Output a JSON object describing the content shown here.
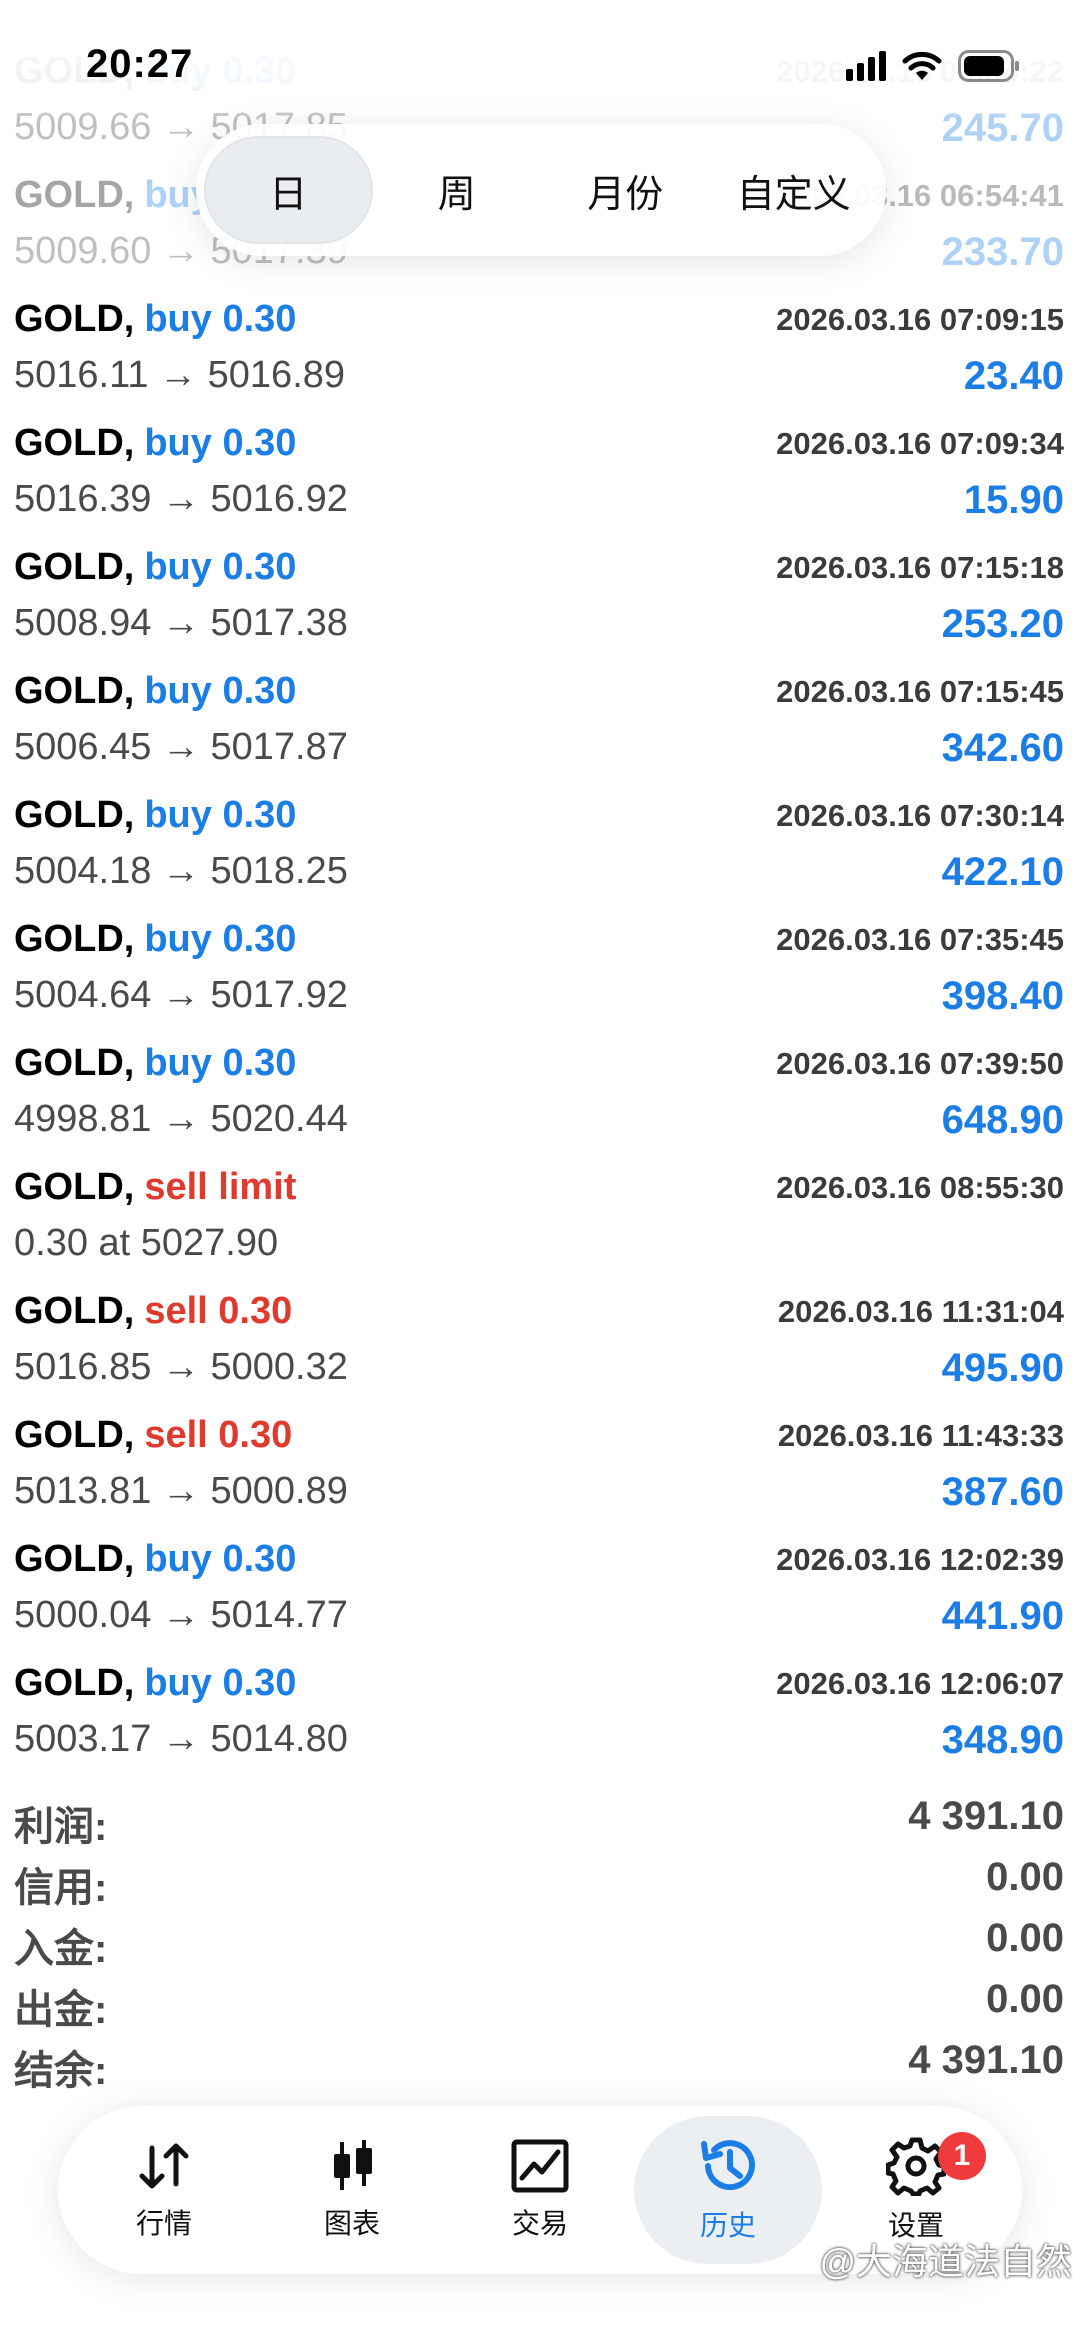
{
  "status_bar": {
    "time": "20:27"
  },
  "period_tabs": [
    {
      "label": "日",
      "active": true
    },
    {
      "label": "周",
      "active": false
    },
    {
      "label": "月份",
      "active": false
    },
    {
      "label": "自定义",
      "active": false
    }
  ],
  "trades": [
    {
      "symbol": "GOLD,",
      "side": "buy",
      "side_label": "buy 0.30",
      "time": "2026.03.16 06:54:22",
      "prices": "5009.66 → 5017.85",
      "profit": "245.70",
      "faded": true
    },
    {
      "symbol": "GOLD,",
      "side": "buy",
      "side_label": "buy 0.30",
      "time": "2026.03.16 06:54:41",
      "prices": "5009.60 → 5017.39",
      "profit": "233.70",
      "faded": true
    },
    {
      "symbol": "GOLD,",
      "side": "buy",
      "side_label": "buy 0.30",
      "time": "2026.03.16 07:09:15",
      "prices": "5016.11 → 5016.89",
      "profit": "23.40",
      "faded": false
    },
    {
      "symbol": "GOLD,",
      "side": "buy",
      "side_label": "buy 0.30",
      "time": "2026.03.16 07:09:34",
      "prices": "5016.39 → 5016.92",
      "profit": "15.90",
      "faded": false
    },
    {
      "symbol": "GOLD,",
      "side": "buy",
      "side_label": "buy 0.30",
      "time": "2026.03.16 07:15:18",
      "prices": "5008.94 → 5017.38",
      "profit": "253.20",
      "faded": false
    },
    {
      "symbol": "GOLD,",
      "side": "buy",
      "side_label": "buy 0.30",
      "time": "2026.03.16 07:15:45",
      "prices": "5006.45 → 5017.87",
      "profit": "342.60",
      "faded": false
    },
    {
      "symbol": "GOLD,",
      "side": "buy",
      "side_label": "buy 0.30",
      "time": "2026.03.16 07:30:14",
      "prices": "5004.18 → 5018.25",
      "profit": "422.10",
      "faded": false
    },
    {
      "symbol": "GOLD,",
      "side": "buy",
      "side_label": "buy 0.30",
      "time": "2026.03.16 07:35:45",
      "prices": "5004.64 → 5017.92",
      "profit": "398.40",
      "faded": false
    },
    {
      "symbol": "GOLD,",
      "side": "buy",
      "side_label": "buy 0.30",
      "time": "2026.03.16 07:39:50",
      "prices": "4998.81 → 5020.44",
      "profit": "648.90",
      "faded": false
    },
    {
      "symbol": "GOLD,",
      "side": "sell",
      "side_label": "sell limit",
      "time": "2026.03.16 08:55:30",
      "prices": "0.30 at 5027.90",
      "profit": "",
      "faded": false
    },
    {
      "symbol": "GOLD,",
      "side": "sell",
      "side_label": "sell 0.30",
      "time": "2026.03.16 11:31:04",
      "prices": "5016.85 → 5000.32",
      "profit": "495.90",
      "faded": false
    },
    {
      "symbol": "GOLD,",
      "side": "sell",
      "side_label": "sell 0.30",
      "time": "2026.03.16 11:43:33",
      "prices": "5013.81 → 5000.89",
      "profit": "387.60",
      "faded": false
    },
    {
      "symbol": "GOLD,",
      "side": "buy",
      "side_label": "buy 0.30",
      "time": "2026.03.16 12:02:39",
      "prices": "5000.04 → 5014.77",
      "profit": "441.90",
      "faded": false
    },
    {
      "symbol": "GOLD,",
      "side": "buy",
      "side_label": "buy 0.30",
      "time": "2026.03.16 12:06:07",
      "prices": "5003.17 → 5014.80",
      "profit": "348.90",
      "faded": false
    }
  ],
  "summary": [
    {
      "label": "利润:",
      "value": "4 391.10"
    },
    {
      "label": "信用:",
      "value": "0.00"
    },
    {
      "label": "入金:",
      "value": "0.00"
    },
    {
      "label": "出金:",
      "value": "0.00"
    },
    {
      "label": "结余:",
      "value": "4 391.10"
    }
  ],
  "bottom_nav": [
    {
      "label": "行情",
      "icon": "arrows-updown-icon",
      "active": false
    },
    {
      "label": "图表",
      "icon": "candlestick-icon",
      "active": false
    },
    {
      "label": "交易",
      "icon": "trade-chart-icon",
      "active": false
    },
    {
      "label": "历史",
      "icon": "history-icon",
      "active": true
    },
    {
      "label": "设置",
      "icon": "gear-icon",
      "active": false,
      "badge": "1"
    }
  ],
  "watermark": "@大海道法自然",
  "colors": {
    "buy": "#1a7ee6",
    "sell": "#e03a2f",
    "active_nav": "#1a7ee6",
    "badge": "#ef3b3b"
  }
}
